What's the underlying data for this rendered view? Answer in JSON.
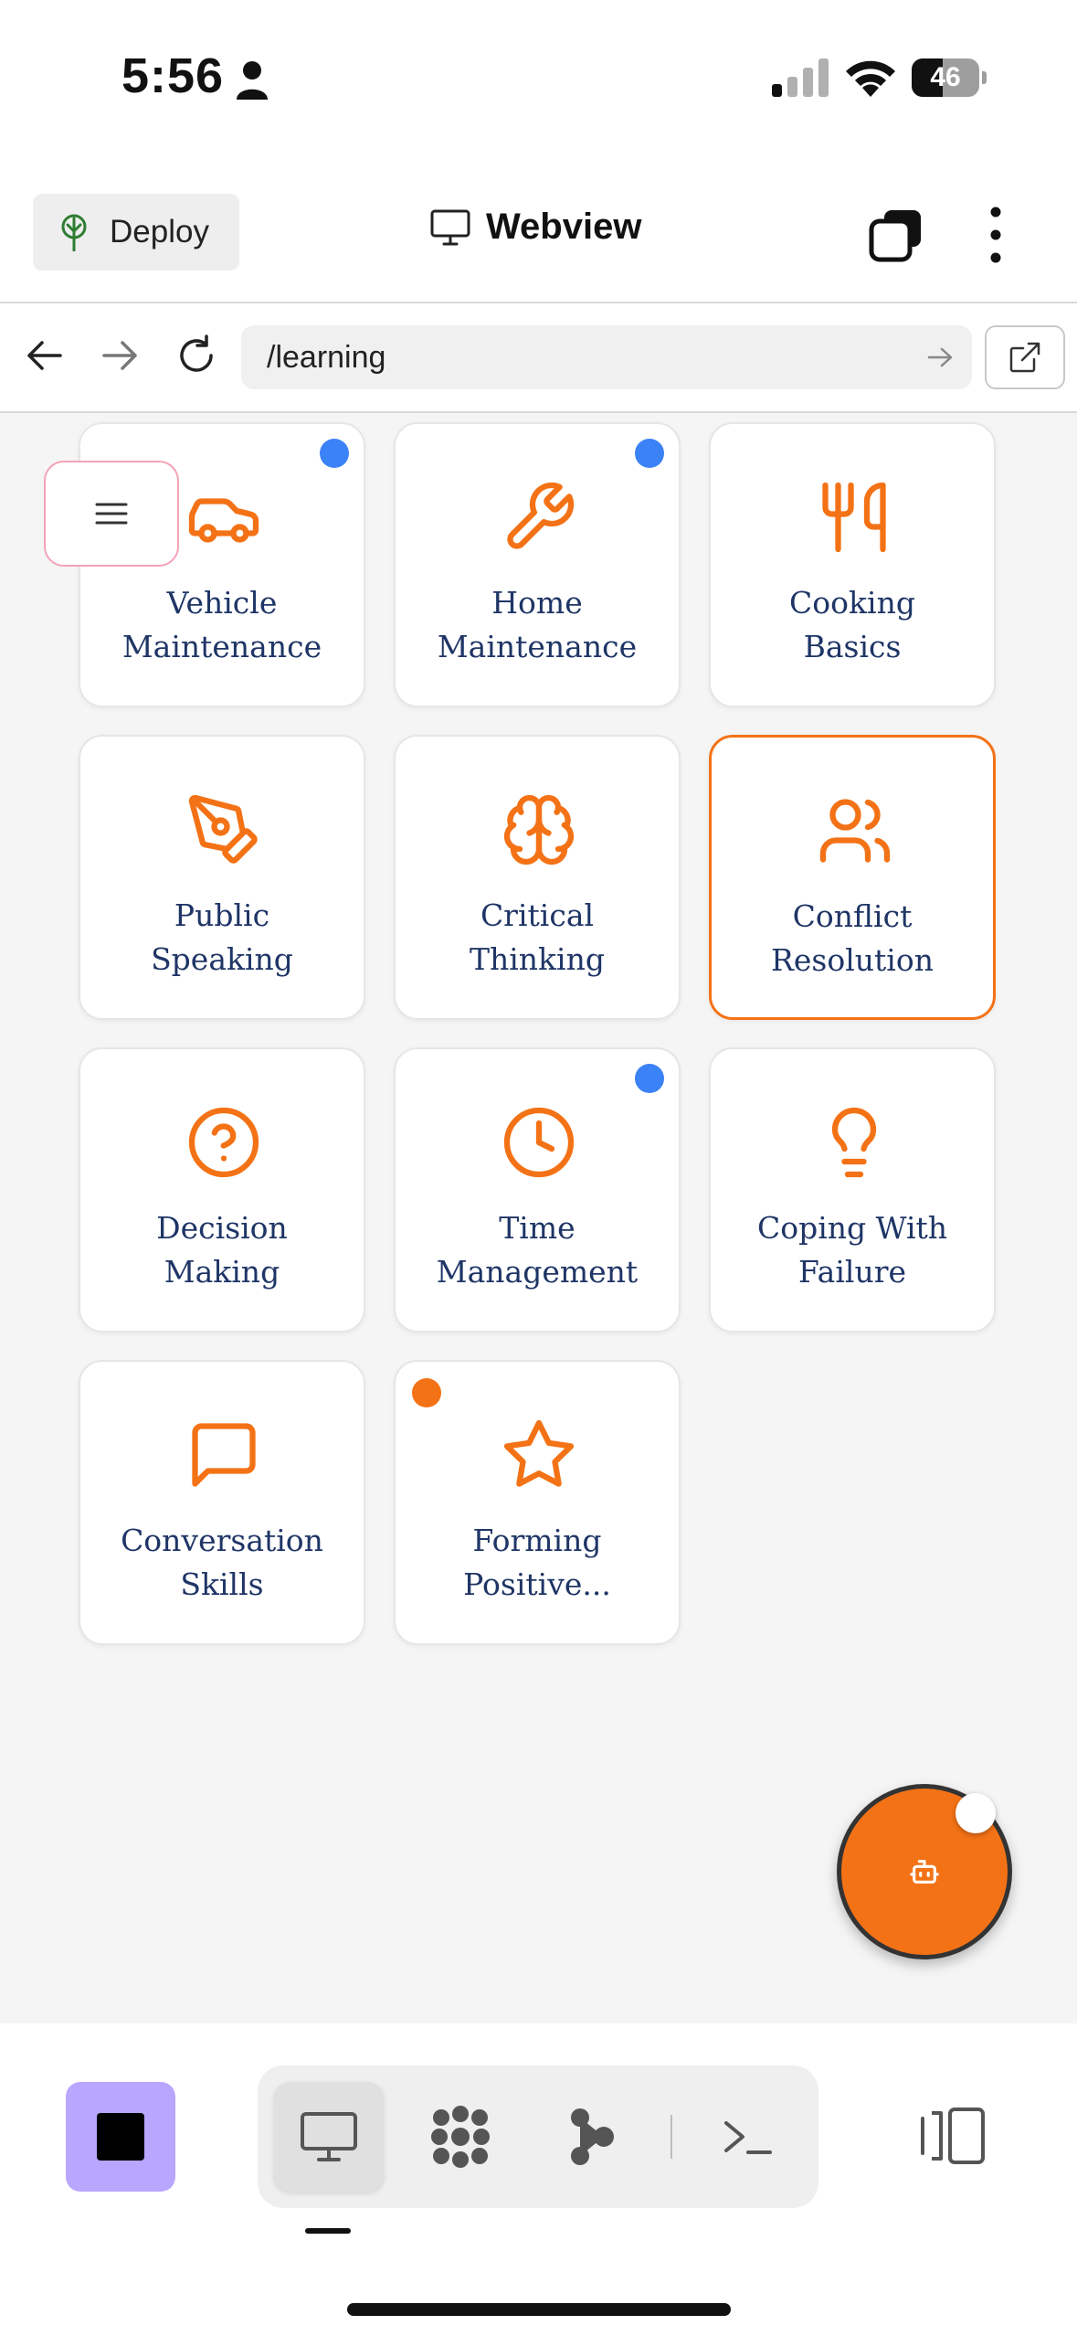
{
  "status_bar": {
    "time": "5:56",
    "battery_level": "46",
    "battery_fraction": 0.46
  },
  "app_bar": {
    "deploy_label": "Deploy",
    "title": "Webview",
    "title_icon": "monitor-icon",
    "layers_icon": "layers-icon",
    "more_icon": "more-vertical-icon"
  },
  "url_bar": {
    "back_icon": "arrow-left-icon",
    "forward_icon": "arrow-right-icon",
    "reload_icon": "reload-icon",
    "url": "/learning",
    "open_external_icon": "external-link-icon"
  },
  "colors": {
    "accent": "#f47216",
    "label": "#1f3566",
    "dot_blue": "#3b82f6",
    "dot_orange": "#f47216",
    "stop_button": "#b9a6ff"
  },
  "cards": [
    {
      "lines": [
        "Vehicle",
        "Maintenance"
      ],
      "icon": "car-icon",
      "dot": "blue"
    },
    {
      "lines": [
        "Home",
        "Maintenance"
      ],
      "icon": "wrench-icon",
      "dot": "blue"
    },
    {
      "lines": [
        "Cooking",
        "Basics"
      ],
      "icon": "utensils-icon",
      "dot": null
    },
    {
      "lines": [
        "Public",
        "Speaking"
      ],
      "icon": "pen-tool-icon",
      "dot": null
    },
    {
      "lines": [
        "Critical",
        "Thinking"
      ],
      "icon": "brain-icon",
      "dot": null
    },
    {
      "lines": [
        "Conflict",
        "Resolution"
      ],
      "icon": "users-icon",
      "dot": null,
      "selected": true
    },
    {
      "lines": [
        "Decision",
        "Making"
      ],
      "icon": "help-circle-icon",
      "dot": null
    },
    {
      "lines": [
        "Time",
        "Management"
      ],
      "icon": "clock-icon",
      "dot": "blue"
    },
    {
      "lines": [
        "Coping With",
        "Failure"
      ],
      "icon": "lightbulb-icon",
      "dot": null
    },
    {
      "lines": [
        "Conversation",
        "Skills"
      ],
      "icon": "message-square-icon",
      "dot": null
    },
    {
      "lines": [
        "Forming",
        "Positive..."
      ],
      "icon": "star-icon",
      "dot": "orange"
    }
  ],
  "floating": {
    "menu_icon": "hamburger-menu-icon",
    "assistant_icon": "bot-icon"
  },
  "bottom_bar": {
    "stop_icon": "stop-icon",
    "tools": [
      {
        "icon": "monitor-icon",
        "active": true
      },
      {
        "icon": "dots-grid-icon",
        "active": false
      },
      {
        "icon": "git-branch-icon",
        "active": false
      },
      {
        "icon": "terminal-icon",
        "active": false
      }
    ],
    "split_icon": "split-view-icon"
  }
}
